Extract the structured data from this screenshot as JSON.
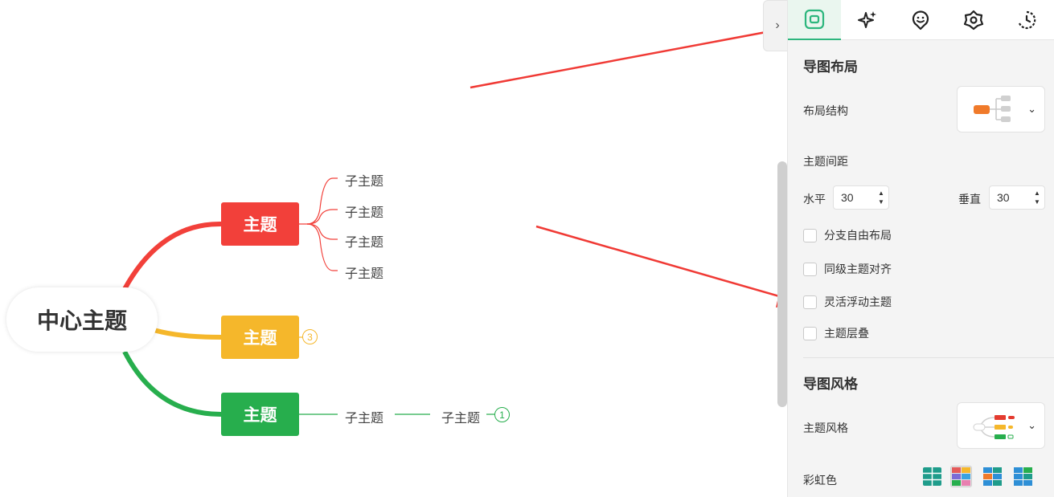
{
  "mindmap": {
    "center": "中心主题",
    "topics": [
      {
        "label": "主题",
        "color": "#f2403a",
        "children": [
          "子主题",
          "子主题",
          "子主题",
          "子主题"
        ]
      },
      {
        "label": "主题",
        "color": "#f5b72b",
        "collapsed_count": "3"
      },
      {
        "label": "主题",
        "color": "#27ae4d",
        "children": [
          "子主题"
        ],
        "grandchild": "子主题",
        "collapsed_count": "1"
      }
    ]
  },
  "panel": {
    "collapse_icon": "chevron-right-icon",
    "tabs": [
      {
        "icon": "layout-icon",
        "active": true
      },
      {
        "icon": "sparkle-icon",
        "active": false
      },
      {
        "icon": "emoji-icon",
        "active": false
      },
      {
        "icon": "badge-icon",
        "active": false
      },
      {
        "icon": "history-icon",
        "active": false
      }
    ],
    "layout_section": {
      "title": "导图布局",
      "structure_label": "布局结构",
      "spacing_label": "主题间距",
      "horizontal_label": "水平",
      "horizontal_value": "30",
      "vertical_label": "垂直",
      "vertical_value": "30",
      "options": [
        {
          "label": "分支自由布局",
          "checked": false
        },
        {
          "label": "同级主题对齐",
          "checked": false
        },
        {
          "label": "灵活浮动主题",
          "checked": false
        },
        {
          "label": "主题层叠",
          "checked": false
        }
      ]
    },
    "style_section": {
      "title": "导图风格",
      "topic_style_label": "主题风格",
      "rainbow_label": "彩虹色",
      "rainbow_selected_index": 1
    }
  },
  "accent_color": "#2cb67d"
}
